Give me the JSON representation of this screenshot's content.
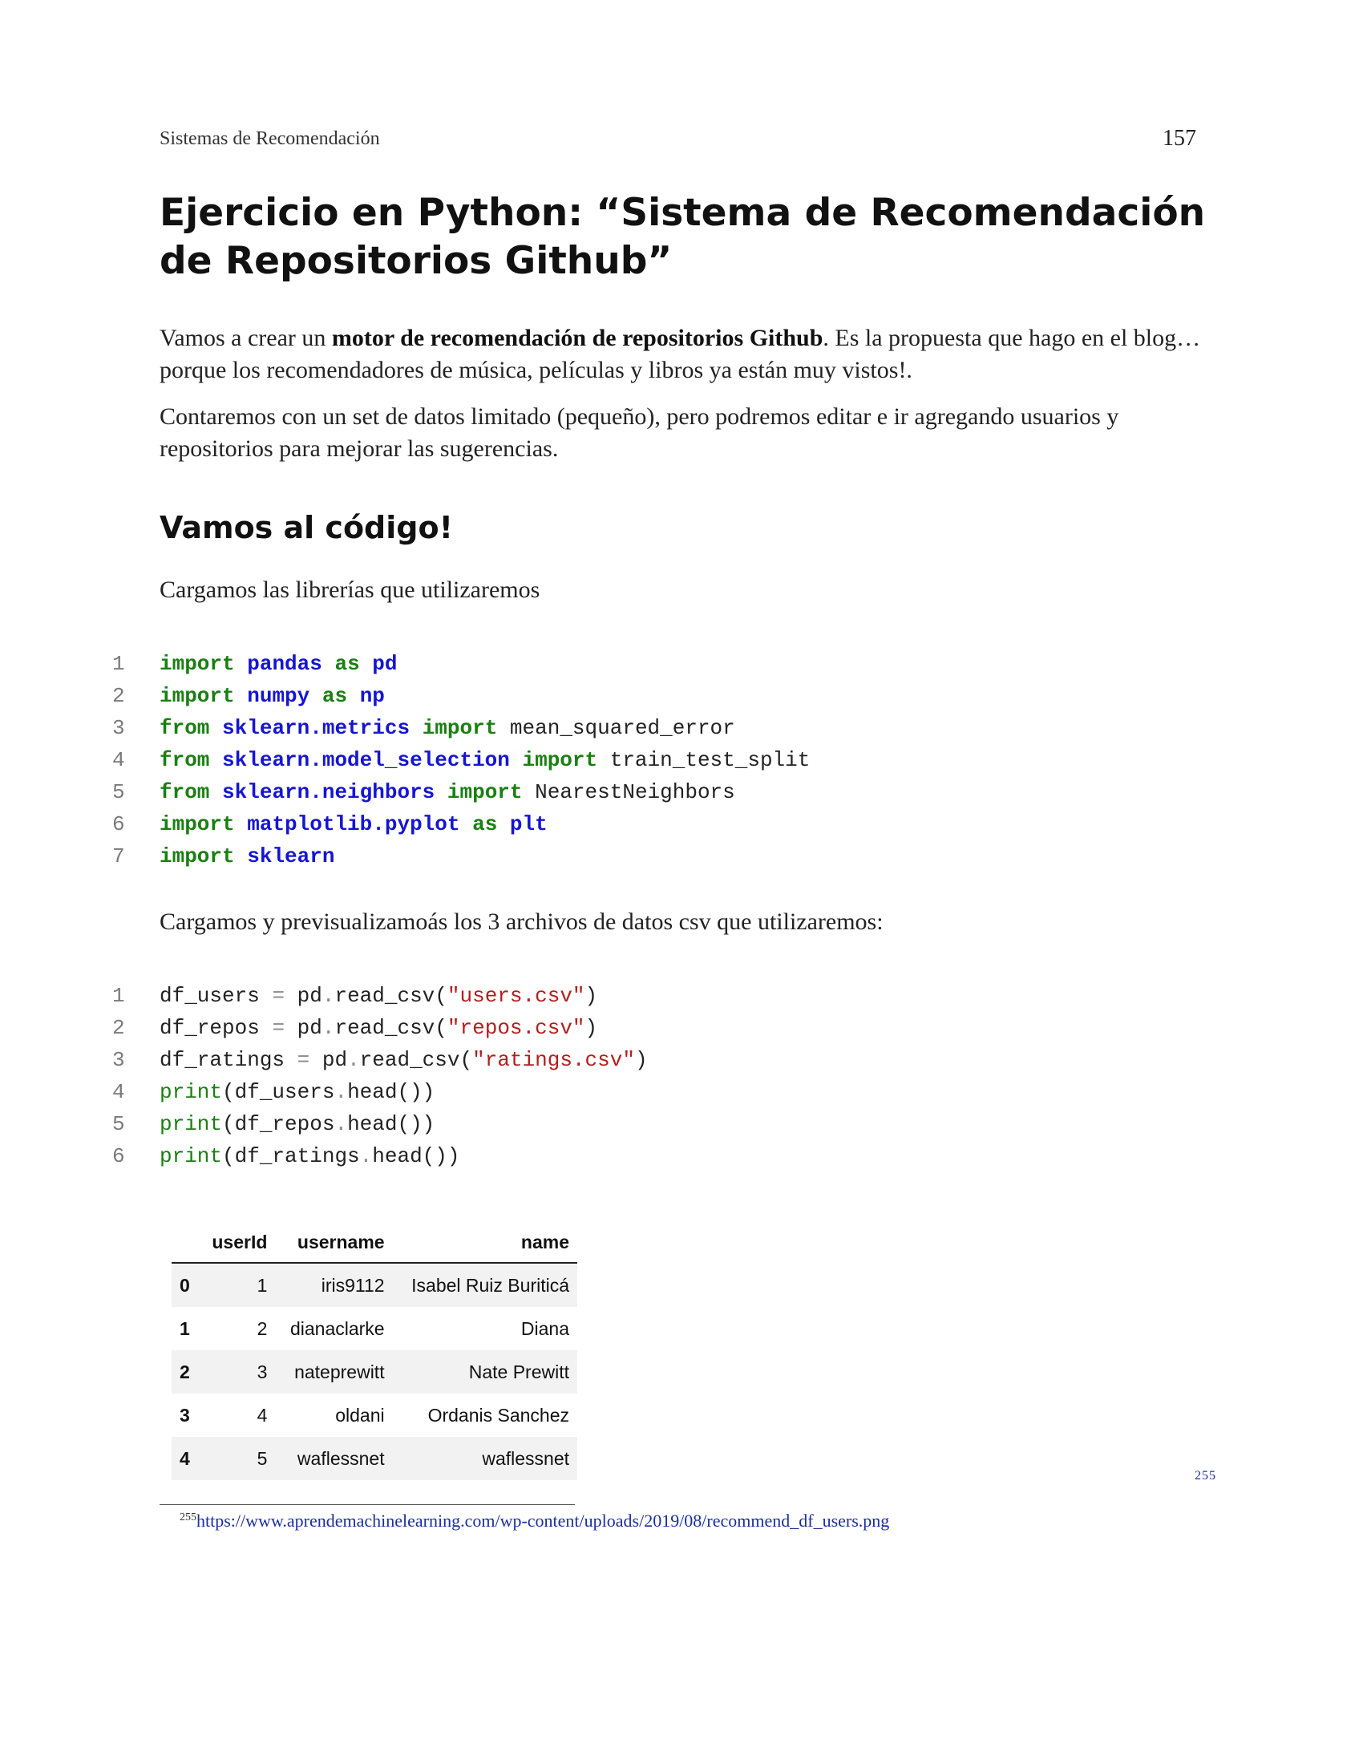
{
  "header": {
    "running_title": "Sistemas de Recomendación",
    "page_number": "157"
  },
  "title": "Ejercicio en Python: “Sistema de Recomendación de Repositorios Github”",
  "intro": {
    "pre": "Vamos a crear un ",
    "bold": "motor de recomendación de repositorios Github",
    "post": ". Es la propuesta que hago en el blog… porque los recomendadores de música, películas y libros ya están muy vistos!."
  },
  "paragraph2": "Contaremos con un set de datos limitado (pequeño), pero podremos editar e ir agregando usuarios y repositorios para mejorar las sugerencias.",
  "subheading": "Vamos al código!",
  "text_libs": "Cargamos las librerías que utilizaremos",
  "code1": [
    {
      "n": "1",
      "t": [
        {
          "c": "kw",
          "v": "import"
        },
        {
          "c": "",
          "v": " "
        },
        {
          "c": "mod",
          "v": "pandas"
        },
        {
          "c": "",
          "v": " "
        },
        {
          "c": "kw",
          "v": "as"
        },
        {
          "c": "",
          "v": " "
        },
        {
          "c": "mod",
          "v": "pd"
        }
      ]
    },
    {
      "n": "2",
      "t": [
        {
          "c": "kw",
          "v": "import"
        },
        {
          "c": "",
          "v": " "
        },
        {
          "c": "mod",
          "v": "numpy"
        },
        {
          "c": "",
          "v": " "
        },
        {
          "c": "kw",
          "v": "as"
        },
        {
          "c": "",
          "v": " "
        },
        {
          "c": "mod",
          "v": "np"
        }
      ]
    },
    {
      "n": "3",
      "t": [
        {
          "c": "kw",
          "v": "from"
        },
        {
          "c": "",
          "v": " "
        },
        {
          "c": "mod",
          "v": "sklearn.metrics"
        },
        {
          "c": "",
          "v": " "
        },
        {
          "c": "kw",
          "v": "import"
        },
        {
          "c": "",
          "v": " mean_squared_error"
        }
      ]
    },
    {
      "n": "4",
      "t": [
        {
          "c": "kw",
          "v": "from"
        },
        {
          "c": "",
          "v": " "
        },
        {
          "c": "mod",
          "v": "sklearn.model_selection"
        },
        {
          "c": "",
          "v": " "
        },
        {
          "c": "kw",
          "v": "import"
        },
        {
          "c": "",
          "v": " train_test_split"
        }
      ]
    },
    {
      "n": "5",
      "t": [
        {
          "c": "kw",
          "v": "from"
        },
        {
          "c": "",
          "v": " "
        },
        {
          "c": "mod",
          "v": "sklearn.neighbors"
        },
        {
          "c": "",
          "v": " "
        },
        {
          "c": "kw",
          "v": "import"
        },
        {
          "c": "",
          "v": " NearestNeighbors"
        }
      ]
    },
    {
      "n": "6",
      "t": [
        {
          "c": "kw",
          "v": "import"
        },
        {
          "c": "",
          "v": " "
        },
        {
          "c": "mod",
          "v": "matplotlib.pyplot"
        },
        {
          "c": "",
          "v": " "
        },
        {
          "c": "kw",
          "v": "as"
        },
        {
          "c": "",
          "v": " "
        },
        {
          "c": "mod",
          "v": "plt"
        }
      ]
    },
    {
      "n": "7",
      "t": [
        {
          "c": "kw",
          "v": "import"
        },
        {
          "c": "",
          "v": " "
        },
        {
          "c": "mod",
          "v": "sklearn"
        }
      ]
    }
  ],
  "text_csv": "Cargamos y previsualizamoás los 3 archivos de datos csv que utilizaremos:",
  "code2": [
    {
      "n": "1",
      "t": [
        {
          "c": "",
          "v": "df_users "
        },
        {
          "c": "op",
          "v": "="
        },
        {
          "c": "",
          "v": " pd"
        },
        {
          "c": "op",
          "v": "."
        },
        {
          "c": "",
          "v": "read_csv("
        },
        {
          "c": "str",
          "v": "\"users.csv\""
        },
        {
          "c": "",
          "v": ")"
        }
      ]
    },
    {
      "n": "2",
      "t": [
        {
          "c": "",
          "v": "df_repos "
        },
        {
          "c": "op",
          "v": "="
        },
        {
          "c": "",
          "v": " pd"
        },
        {
          "c": "op",
          "v": "."
        },
        {
          "c": "",
          "v": "read_csv("
        },
        {
          "c": "str",
          "v": "\"repos.csv\""
        },
        {
          "c": "",
          "v": ")"
        }
      ]
    },
    {
      "n": "3",
      "t": [
        {
          "c": "",
          "v": "df_ratings "
        },
        {
          "c": "op",
          "v": "="
        },
        {
          "c": "",
          "v": " pd"
        },
        {
          "c": "op",
          "v": "."
        },
        {
          "c": "",
          "v": "read_csv("
        },
        {
          "c": "str",
          "v": "\"ratings.csv\""
        },
        {
          "c": "",
          "v": ")"
        }
      ]
    },
    {
      "n": "4",
      "t": [
        {
          "c": "fn",
          "v": "print"
        },
        {
          "c": "",
          "v": "(df_users"
        },
        {
          "c": "op",
          "v": "."
        },
        {
          "c": "",
          "v": "head())"
        }
      ]
    },
    {
      "n": "5",
      "t": [
        {
          "c": "fn",
          "v": "print"
        },
        {
          "c": "",
          "v": "(df_repos"
        },
        {
          "c": "op",
          "v": "."
        },
        {
          "c": "",
          "v": "head())"
        }
      ]
    },
    {
      "n": "6",
      "t": [
        {
          "c": "fn",
          "v": "print"
        },
        {
          "c": "",
          "v": "(df_ratings"
        },
        {
          "c": "op",
          "v": "."
        },
        {
          "c": "",
          "v": "head())"
        }
      ]
    }
  ],
  "table": {
    "columns": [
      "",
      "userId",
      "username",
      "name"
    ],
    "rows": [
      [
        "0",
        "1",
        "iris9112",
        "Isabel Ruiz Buriticá"
      ],
      [
        "1",
        "2",
        "dianaclarke",
        "Diana"
      ],
      [
        "2",
        "3",
        "nateprewitt",
        "Nate Prewitt"
      ],
      [
        "3",
        "4",
        "oldani",
        "Ordanis Sanchez"
      ],
      [
        "4",
        "5",
        "waflessnet",
        "waflessnet"
      ]
    ]
  },
  "footnote": {
    "marker": "255",
    "url": "https://www.aprendemachinelearning.com/wp-content/uploads/2019/08/recommend_df_users.png"
  },
  "colors": {
    "keyword": "#1a7f12",
    "module": "#1515d0",
    "string": "#b21e1e",
    "link": "#1a2f9e"
  }
}
